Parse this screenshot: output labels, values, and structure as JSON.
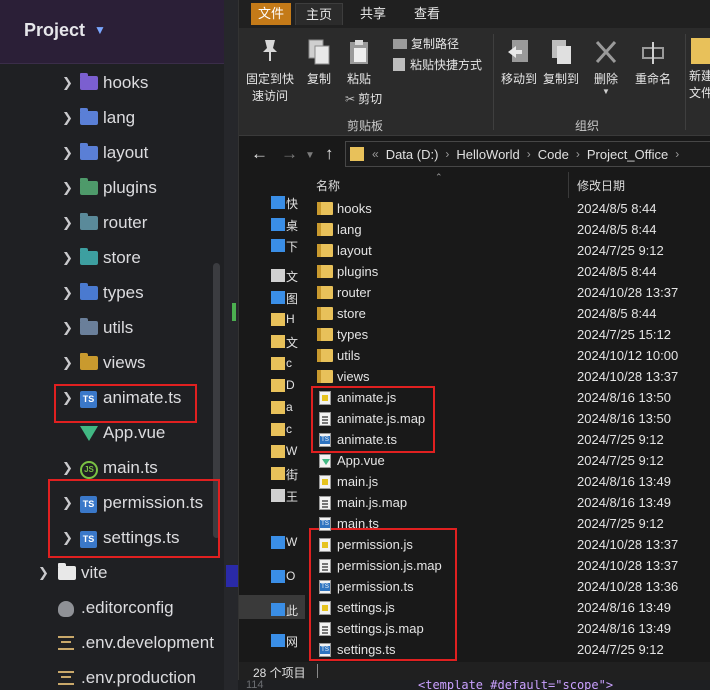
{
  "ide": {
    "project_title": "Project",
    "tree": [
      {
        "label": "hooks",
        "kind": "folder",
        "color": "#7b5fd0",
        "expandable": true
      },
      {
        "label": "lang",
        "kind": "folder",
        "color": "#5a7fd6",
        "expandable": true
      },
      {
        "label": "layout",
        "kind": "folder",
        "color": "#5a7fd6",
        "expandable": true
      },
      {
        "label": "plugins",
        "kind": "folder",
        "color": "#4e9a6a",
        "expandable": true
      },
      {
        "label": "router",
        "kind": "folder",
        "color": "#5a8a9a",
        "expandable": true
      },
      {
        "label": "store",
        "kind": "folder",
        "color": "#3d9fa0",
        "expandable": true
      },
      {
        "label": "types",
        "kind": "folder",
        "color": "#4a7ad0",
        "expandable": true
      },
      {
        "label": "utils",
        "kind": "folder",
        "color": "#6a7f9a",
        "expandable": true
      },
      {
        "label": "views",
        "kind": "folder",
        "color": "#c99a2e",
        "expandable": true
      },
      {
        "label": "animate.ts",
        "kind": "ts",
        "expandable": true
      },
      {
        "label": "App.vue",
        "kind": "vue",
        "expandable": false
      },
      {
        "label": "main.ts",
        "kind": "js",
        "expandable": true
      },
      {
        "label": "permission.ts",
        "kind": "ts",
        "expandable": true
      },
      {
        "label": "settings.ts",
        "kind": "ts",
        "expandable": true
      },
      {
        "label": "vite",
        "kind": "folder-white",
        "expandable": true
      },
      {
        "label": ".editorconfig",
        "kind": "rat",
        "expandable": false
      },
      {
        "label": ".env.development",
        "kind": "cfg",
        "expandable": false
      },
      {
        "label": ".env.production",
        "kind": "cfg",
        "expandable": false
      }
    ]
  },
  "explorer": {
    "menu": {
      "file": "文件",
      "home": "主页",
      "share": "共享",
      "view": "查看"
    },
    "ribbon": {
      "pin": "固定到快\n速访问",
      "copy": "复制",
      "paste": "粘贴",
      "copy_path": "复制路径",
      "paste_shortcut": "粘贴快捷方式",
      "cut": "剪切",
      "clipboard_group": "剪贴板",
      "move_to": "移动到",
      "copy_to": "复制到",
      "delete": "删除",
      "rename": "重命名",
      "organize_group": "组织",
      "new_folder": "新建\n文件"
    },
    "breadcrumb": [
      "Data (D:)",
      "HelloWorld",
      "Code",
      "Project_Office"
    ],
    "nav_pane": [
      {
        "label": "快",
        "icon": "star-icon"
      },
      {
        "label": "桌",
        "icon": "desktop-icon"
      },
      {
        "label": "下",
        "icon": "download-icon"
      },
      {
        "label": "文",
        "icon": "document-icon"
      },
      {
        "label": "图",
        "icon": "picture-icon"
      },
      {
        "label": "H",
        "icon": "folder-icon"
      },
      {
        "label": "文",
        "icon": "folder-icon"
      },
      {
        "label": "c",
        "icon": "folder-icon"
      },
      {
        "label": "D",
        "icon": "folder-icon"
      },
      {
        "label": "a",
        "icon": "folder-icon"
      },
      {
        "label": "c",
        "icon": "folder-icon"
      },
      {
        "label": "W",
        "icon": "folder-icon"
      },
      {
        "label": "街",
        "icon": "folder-icon"
      },
      {
        "label": "王",
        "icon": "doc-icon"
      },
      {
        "label": "W",
        "icon": "onedrive-icon"
      },
      {
        "label": "O",
        "icon": "onedrive-icon"
      },
      {
        "label": "此",
        "icon": "computer-icon"
      },
      {
        "label": "网",
        "icon": "network-icon"
      }
    ],
    "columns": {
      "name": "名称",
      "modified": "修改日期"
    },
    "files": [
      {
        "name": "hooks",
        "date": "2024/8/5 8:44",
        "type": "folder"
      },
      {
        "name": "lang",
        "date": "2024/8/5 8:44",
        "type": "folder"
      },
      {
        "name": "layout",
        "date": "2024/7/25 9:12",
        "type": "folder"
      },
      {
        "name": "plugins",
        "date": "2024/8/5 8:44",
        "type": "folder"
      },
      {
        "name": "router",
        "date": "2024/10/28 13:37",
        "type": "folder"
      },
      {
        "name": "store",
        "date": "2024/8/5 8:44",
        "type": "folder"
      },
      {
        "name": "types",
        "date": "2024/7/25 15:12",
        "type": "folder"
      },
      {
        "name": "utils",
        "date": "2024/10/12 10:00",
        "type": "folder"
      },
      {
        "name": "views",
        "date": "2024/10/28 13:37",
        "type": "folder"
      },
      {
        "name": "animate.js",
        "date": "2024/8/16 13:50",
        "type": "js"
      },
      {
        "name": "animate.js.map",
        "date": "2024/8/16 13:50",
        "type": "map"
      },
      {
        "name": "animate.ts",
        "date": "2024/7/25 9:12",
        "type": "ts"
      },
      {
        "name": "App.vue",
        "date": "2024/7/25 9:12",
        "type": "vue"
      },
      {
        "name": "main.js",
        "date": "2024/8/16 13:49",
        "type": "js"
      },
      {
        "name": "main.js.map",
        "date": "2024/8/16 13:49",
        "type": "map"
      },
      {
        "name": "main.ts",
        "date": "2024/7/25 9:12",
        "type": "ts"
      },
      {
        "name": "permission.js",
        "date": "2024/10/28 13:37",
        "type": "js"
      },
      {
        "name": "permission.js.map",
        "date": "2024/10/28 13:37",
        "type": "map"
      },
      {
        "name": "permission.ts",
        "date": "2024/10/28 13:36",
        "type": "ts"
      },
      {
        "name": "settings.js",
        "date": "2024/8/16 13:49",
        "type": "js"
      },
      {
        "name": "settings.js.map",
        "date": "2024/8/16 13:49",
        "type": "map"
      },
      {
        "name": "settings.ts",
        "date": "2024/7/25 9:12",
        "type": "ts"
      }
    ],
    "status": "28 个项目"
  },
  "code_snippet": "<template #default=\"scope\">",
  "line_number": "114"
}
